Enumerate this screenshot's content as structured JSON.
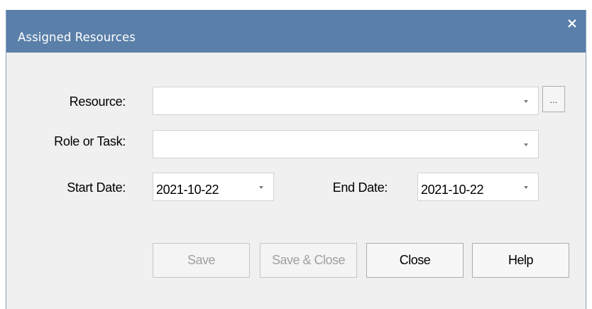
{
  "window": {
    "title": "Assigned Resources",
    "close_glyph": "✕"
  },
  "form": {
    "resource_label": "Resource:",
    "resource_value": "",
    "browse_label": "...",
    "role_label": "Role or Task:",
    "role_value": "",
    "start_label": "Start Date:",
    "start_value": "2021-10-22",
    "end_label": "End Date:",
    "end_value": "2021-10-22"
  },
  "buttons": {
    "save": "Save",
    "save_close": "Save & Close",
    "close": "Close",
    "help": "Help"
  },
  "states": {
    "save_enabled": false,
    "save_close_enabled": false
  },
  "colors": {
    "titlebar": "#5a7fa9",
    "dialog_bg": "#f0f0f0",
    "disabled_text": "#a0a0a0"
  },
  "icons": {
    "close": "close-icon",
    "dropdown": "chevron-down-icon"
  }
}
